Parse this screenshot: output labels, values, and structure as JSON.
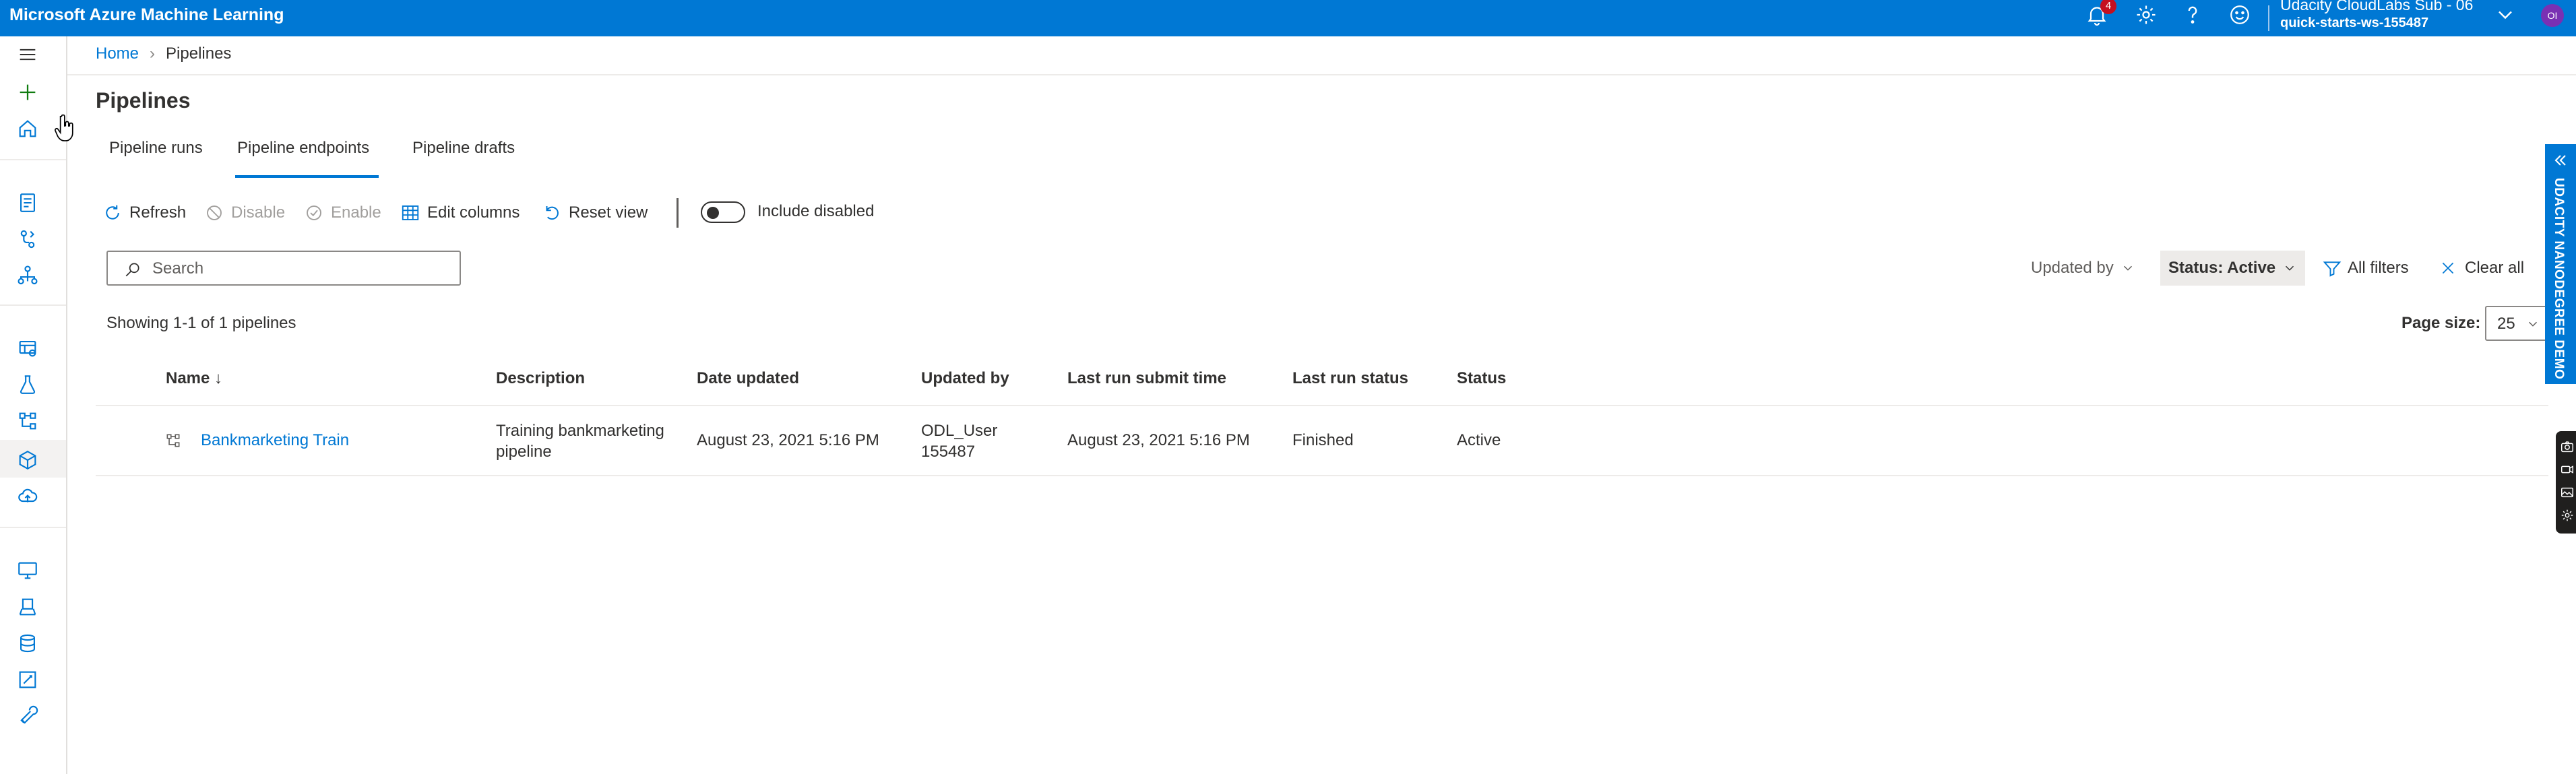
{
  "app": {
    "title": "Microsoft Azure Machine Learning"
  },
  "topbar": {
    "notification_count": "4",
    "icons": [
      "bell-icon",
      "gear-icon",
      "help-icon",
      "feedback-icon"
    ],
    "account": {
      "name": "Udacity CloudLabs Sub - 06",
      "workspace": "quick-starts-ws-155487",
      "initials": "OI"
    }
  },
  "rail": {
    "icons": [
      "hamburger-icon",
      "plus-icon",
      "home-icon",
      "notebook-icon",
      "automl-icon",
      "designer-icon",
      "datasets-icon",
      "experiments-icon",
      "pipelines-icon",
      "models-icon",
      "endpoints-icon",
      "compute-icon",
      "environments-icon",
      "datastores-icon",
      "data-labeling-icon",
      "linked-services-icon"
    ],
    "selected": "pipelines-icon"
  },
  "breadcrumb": {
    "home": "Home",
    "current": "Pipelines"
  },
  "page": {
    "title": "Pipelines"
  },
  "tabs": [
    {
      "label": "Pipeline runs",
      "active": false
    },
    {
      "label": "Pipeline endpoints",
      "active": true
    },
    {
      "label": "Pipeline drafts",
      "active": false
    }
  ],
  "toolbar": {
    "refresh": "Refresh",
    "disable": "Disable",
    "enable": "Enable",
    "edit_columns": "Edit columns",
    "reset_view": "Reset view",
    "include_disabled": "Include disabled",
    "include_disabled_on": false
  },
  "search": {
    "placeholder": "Search",
    "value": ""
  },
  "filters": {
    "updated_by": "Updated by",
    "status": "Status: Active",
    "all_filters": "All filters",
    "clear_all": "Clear all"
  },
  "list": {
    "showing": "Showing 1-1 of 1 pipelines",
    "page_size_label": "Page size:",
    "page_size": "25",
    "columns": [
      "Name ↓",
      "Description",
      "Date updated",
      "Updated by",
      "Last run submit time",
      "Last run status",
      "Status"
    ],
    "rows": [
      {
        "name": "Bankmarketing Train",
        "description": "Training bankmarketing pipeline",
        "date_updated": "August 23, 2021 5:16 PM",
        "updated_by": "ODL_User 155487",
        "last_run_submit": "August 23, 2021 5:16 PM",
        "last_run_status": "Finished",
        "status": "Active"
      }
    ]
  },
  "side_panel": {
    "label": "UDACITY NANODEGREE DEMO"
  },
  "colors": {
    "brand": "#0078d4",
    "avatar": "#7a30b3",
    "badge": "#c50f1f"
  }
}
